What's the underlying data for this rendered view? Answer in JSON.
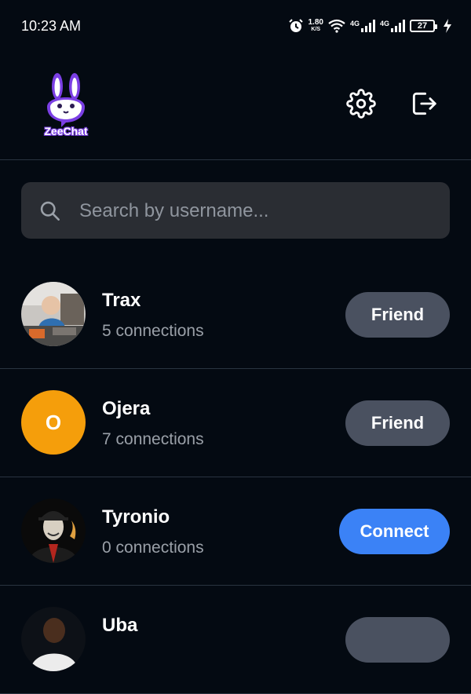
{
  "status_bar": {
    "time": "10:23 AM",
    "speed_value": "1.80",
    "speed_unit": "K/S",
    "net1": "4G",
    "net2": "4G",
    "battery": "27"
  },
  "header": {
    "logo_text": "ZeeChat",
    "icons": [
      "settings-icon",
      "logout-icon"
    ]
  },
  "search": {
    "placeholder": "Search by username..."
  },
  "users": [
    {
      "name": "Trax",
      "connections": "5 connections",
      "action": "Friend",
      "avatar": "photo"
    },
    {
      "name": "Ojera",
      "connections": "7 connections",
      "action": "Friend",
      "avatar_initial": "O",
      "avatar_color": "#f59e0b"
    },
    {
      "name": "Tyronio",
      "connections": "0 connections",
      "action": "Connect",
      "avatar": "photo"
    },
    {
      "name": "Uba",
      "connections": "",
      "action": "",
      "avatar": "photo"
    }
  ],
  "colors": {
    "background": "#040a12",
    "friend_button": "#4a5160",
    "connect_button": "#3b82f6",
    "search_bg": "#2a2d33"
  }
}
